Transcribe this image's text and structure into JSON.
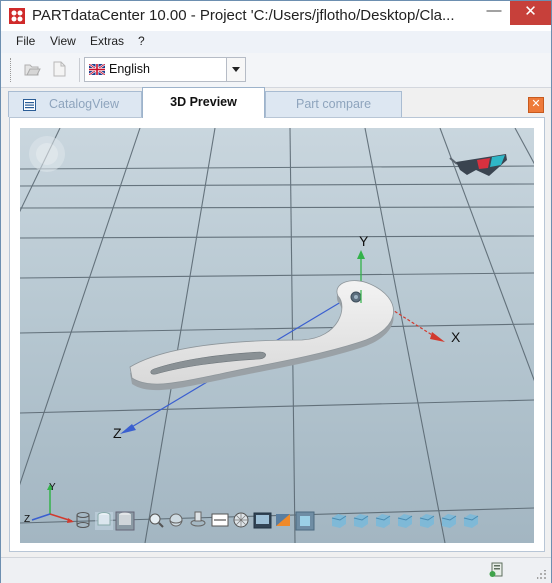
{
  "window": {
    "title": "PARTdataCenter 10.00 - Project 'C:/Users/jflotho/Desktop/Cla..."
  },
  "menu": {
    "items": [
      "File",
      "View",
      "Extras",
      "?"
    ]
  },
  "toolbar": {
    "language_selected": "English"
  },
  "tabs": [
    {
      "label": "CatalogView",
      "active": false
    },
    {
      "label": "3D Preview",
      "active": true
    },
    {
      "label": "Part compare",
      "active": false
    }
  ],
  "viewport": {
    "axis_labels": {
      "x": "X",
      "y": "Y",
      "z": "Z"
    },
    "mini_axis_labels": {
      "y": "Y",
      "z": "Z"
    },
    "bottom_toolbar_icons": [
      "cylinder-wire-icon",
      "cylinder-ghost-icon",
      "cylinder-solid-icon",
      "zoom-icon",
      "rotate-sphere-icon",
      "rotate-around-icon",
      "dimension-icon",
      "wireframe-sphere-icon",
      "screenshot-icon",
      "section-icon",
      "box-select-icon",
      "view-iso-1-icon",
      "view-iso-2-icon",
      "view-iso-3-icon",
      "view-iso-4-icon",
      "view-iso-5-icon",
      "view-iso-6-icon",
      "view-iso-7-icon"
    ]
  },
  "colors": {
    "axis_x": "#d23a2e",
    "axis_y": "#33b24a",
    "axis_z": "#3a5fd0",
    "background_sky": "#c8d6df",
    "background_floor": "#a9bcc8"
  }
}
